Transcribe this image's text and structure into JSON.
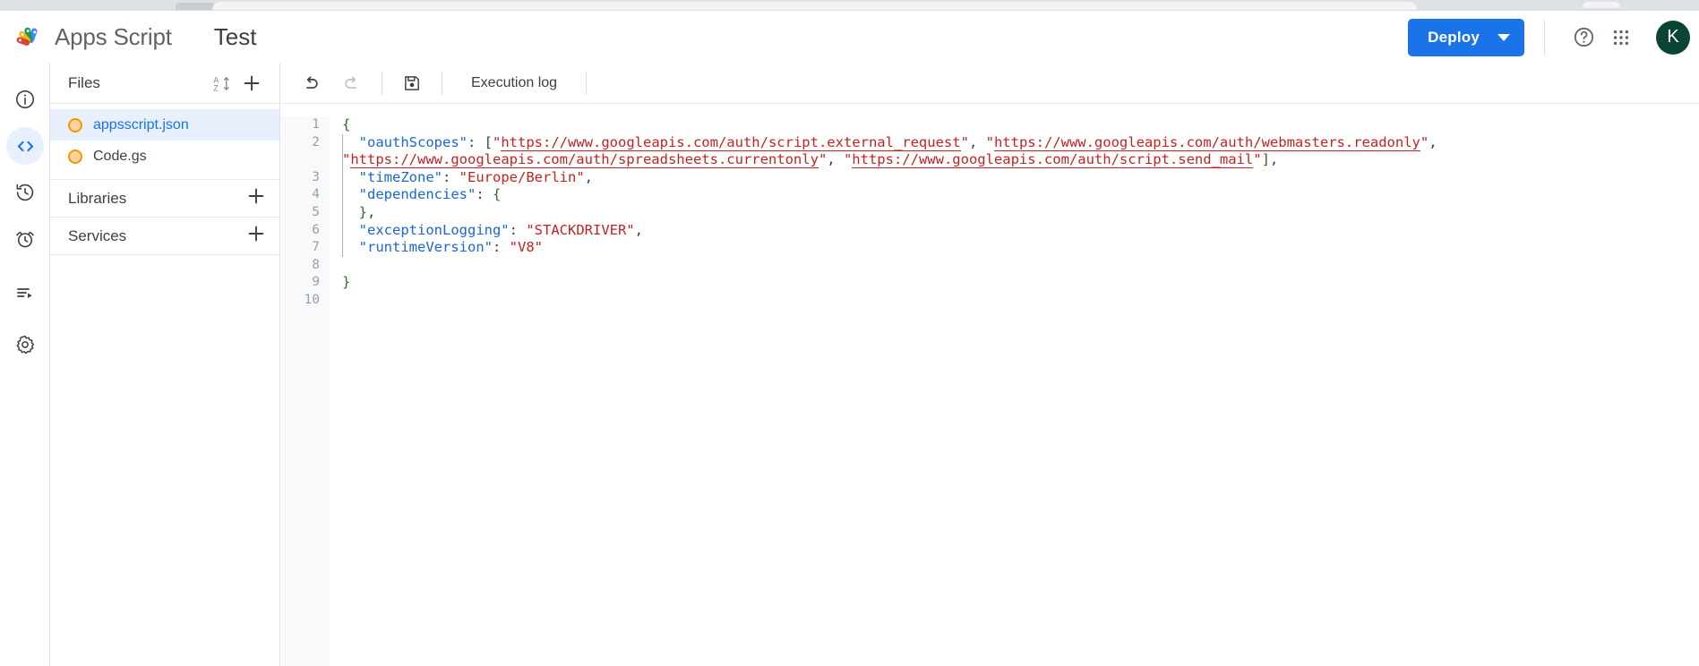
{
  "browser": {
    "chrome_visible": true
  },
  "appbar": {
    "brand_name": "Apps Script",
    "project_title": "Test",
    "deploy_label": "Deploy",
    "help_icon": "help-circle-icon",
    "apps_icon": "apps-grid-icon",
    "avatar_initial": "K",
    "avatar_color": "#0b4434",
    "accent_color": "#1a73e8"
  },
  "rail": {
    "items": [
      {
        "name": "overview",
        "icon": "info-circle-icon",
        "active": false
      },
      {
        "name": "editor",
        "icon": "code-brackets-icon",
        "active": true
      },
      {
        "name": "project-history",
        "icon": "history-clock-icon",
        "active": false
      },
      {
        "name": "triggers",
        "icon": "alarm-clock-icon",
        "active": false
      },
      {
        "name": "executions",
        "icon": "executions-list-icon",
        "active": false
      },
      {
        "name": "settings",
        "icon": "gear-icon",
        "active": false
      }
    ]
  },
  "files_panel": {
    "header": "Files",
    "sort_icon": "sort-az-icon",
    "add_icon": "plus-icon",
    "files": [
      {
        "name": "appsscript.json",
        "selected": true,
        "icon": "file-dot-icon"
      },
      {
        "name": "Code.gs",
        "selected": false,
        "icon": "file-dot-icon"
      }
    ],
    "sections": [
      {
        "label": "Libraries",
        "add_icon": "plus-icon"
      },
      {
        "label": "Services",
        "add_icon": "plus-icon"
      }
    ]
  },
  "editor": {
    "toolbar": {
      "undo_icon": "undo-icon",
      "redo_icon": "redo-icon",
      "save_icon": "save-floppy-icon",
      "execution_log_label": "Execution log"
    },
    "filename": "appsscript.json",
    "line_numbers": [
      "1",
      "2",
      "3",
      "4",
      "5",
      "6",
      "7",
      "8",
      "9",
      "10"
    ],
    "oauth_scopes": [
      "https://www.googleapis.com/auth/script.external_request",
      "https://www.googleapis.com/auth/webmasters.readonly",
      "https://www.googleapis.com/auth/spreadsheets.currentonly",
      "https://www.googleapis.com/auth/script.send_mail"
    ],
    "keys": {
      "oauthScopes": "\"oauthScopes\"",
      "timeZone": "\"timeZone\"",
      "dependencies": "\"dependencies\"",
      "exceptionLogging": "\"exceptionLogging\"",
      "runtimeVersion": "\"runtimeVersion\""
    },
    "values": {
      "timeZone": "\"Europe/Berlin\"",
      "exceptionLogging": "\"STACKDRIVER\"",
      "runtimeVersion": "\"V8\""
    },
    "line1": "{",
    "line9": "}",
    "colors": {
      "key": "#1967d2",
      "string": "#c5221f",
      "brace": "#33691e",
      "gutter_bg": "#f8f9fa",
      "line_number": "#9aa0a6"
    }
  }
}
